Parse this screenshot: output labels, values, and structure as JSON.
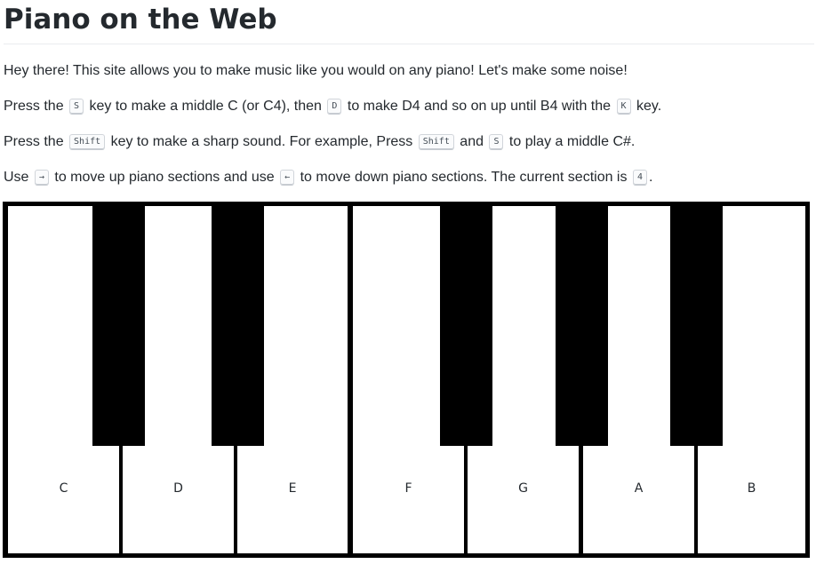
{
  "page": {
    "title": "Piano on the Web"
  },
  "intro": {
    "text": "Hey there! This site allows you to make music like you would on any piano! Let's make some noise!"
  },
  "notes_line": {
    "part1": "Press the ",
    "key1": "S",
    "part2": " key to make a middle C (or C4), then ",
    "key2": "D",
    "part3": " to make D4 and so on up until B4 with the ",
    "key3": "K",
    "part4": " key."
  },
  "sharp_line": {
    "part1": "Press the ",
    "key1": "Shift",
    "part2": " key to make a sharp sound. For example, Press ",
    "key2": "Shift",
    "part3": " and ",
    "key3": "S",
    "part4": " to play a middle C#."
  },
  "section_line": {
    "part1": "Use ",
    "key1": "→",
    "part2": " to move up piano sections and use ",
    "key2": "←",
    "part3": " to move down piano sections. The current section is ",
    "current_section": "4",
    "part4": "."
  },
  "piano": {
    "white_keys": [
      "C",
      "D",
      "E",
      "F",
      "G",
      "A",
      "B"
    ],
    "colors": {
      "white_key": "#ffffff",
      "black_key": "#000000",
      "border": "#000000"
    }
  }
}
